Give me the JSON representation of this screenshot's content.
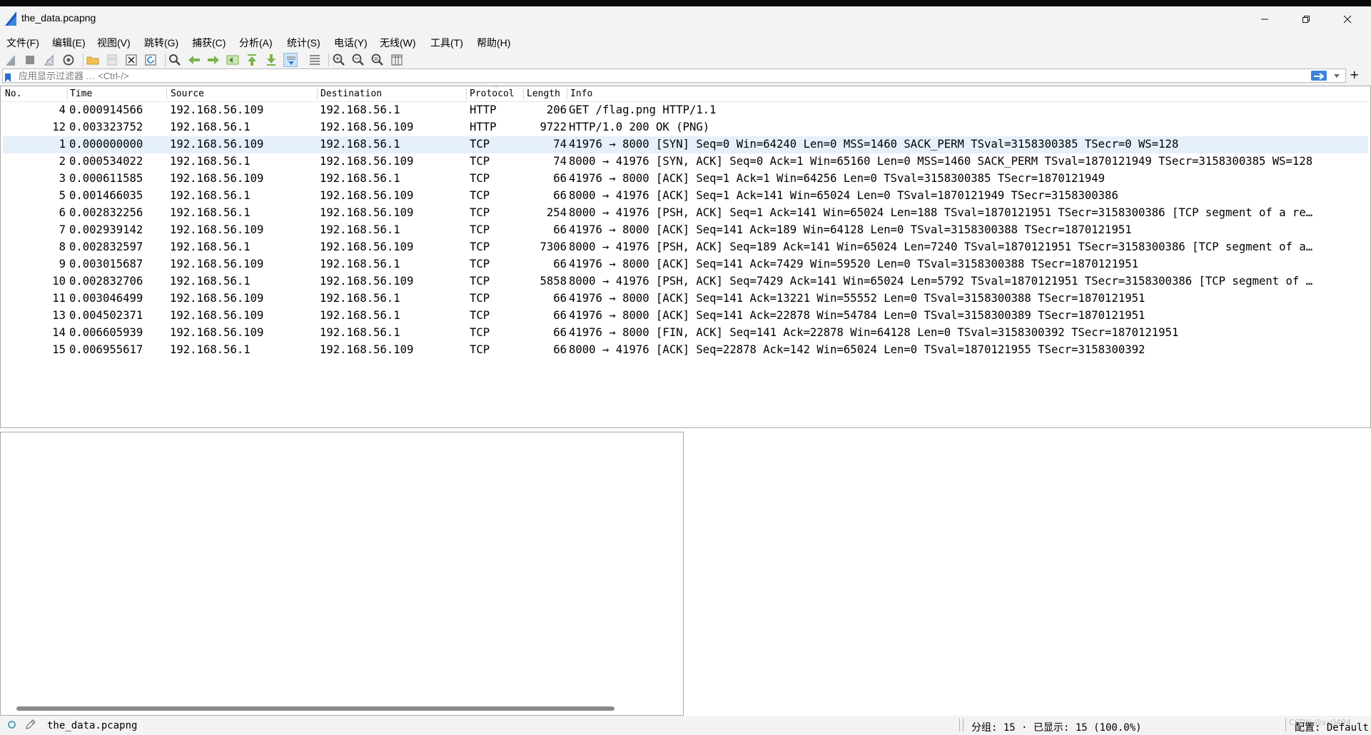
{
  "window": {
    "title": "the_data.pcapng",
    "icon": "wireshark-fin-icon",
    "controls": [
      "minimize-icon",
      "restore-icon",
      "close-icon"
    ]
  },
  "menu": [
    {
      "label": "文件(F)"
    },
    {
      "label": "编辑(E)"
    },
    {
      "label": "视图(V)"
    },
    {
      "label": "跳转(G)"
    },
    {
      "label": "捕获(C)"
    },
    {
      "label": "分析(A)"
    },
    {
      "label": "统计(S)"
    },
    {
      "label": "电话(Y)"
    },
    {
      "label": "无线(W)"
    },
    {
      "label": "工具(T)"
    },
    {
      "label": "帮助(H)"
    }
  ],
  "toolbar": {
    "icons": [
      "start-capture-icon",
      "stop-capture-icon",
      "restart-capture-icon",
      "capture-options-icon",
      "open-file-icon",
      "save-file-icon",
      "close-file-icon",
      "reload-file-icon",
      "find-packet-icon",
      "go-back-icon",
      "go-forward-icon",
      "go-to-packet-icon",
      "go-first-icon",
      "go-last-icon",
      "autoscroll-icon",
      "colorize-icon",
      "zoom-in-icon",
      "zoom-out-icon",
      "zoom-normal-icon",
      "resize-columns-icon"
    ]
  },
  "filter": {
    "placeholder": "应用显示过滤器 … <Ctrl-/>",
    "value": "",
    "apply_color": "#3c82d8",
    "add_label": "+"
  },
  "packet_list": {
    "columns": [
      "No.",
      "Time",
      "Source",
      "Destination",
      "Protocol",
      "Length",
      "Info"
    ],
    "selected_row_color": "#e6f0fb",
    "rows": [
      {
        "no": "4",
        "time": "0.000914566",
        "src": "192.168.56.109",
        "dst": "192.168.56.1",
        "proto": "HTTP",
        "len": "206",
        "info": "GET /flag.png HTTP/1.1"
      },
      {
        "no": "12",
        "time": "0.003323752",
        "src": "192.168.56.1",
        "dst": "192.168.56.109",
        "proto": "HTTP",
        "len": "9722",
        "info": "HTTP/1.0 200 OK  (PNG)"
      },
      {
        "no": "1",
        "time": "0.000000000",
        "src": "192.168.56.109",
        "dst": "192.168.56.1",
        "proto": "TCP",
        "len": "74",
        "info": "41976 → 8000 [SYN] Seq=0 Win=64240 Len=0 MSS=1460 SACK_PERM TSval=3158300385 TSecr=0 WS=128"
      },
      {
        "no": "2",
        "time": "0.000534022",
        "src": "192.168.56.1",
        "dst": "192.168.56.109",
        "proto": "TCP",
        "len": "74",
        "info": "8000 → 41976 [SYN, ACK] Seq=0 Ack=1 Win=65160 Len=0 MSS=1460 SACK_PERM TSval=1870121949 TSecr=3158300385 WS=128"
      },
      {
        "no": "3",
        "time": "0.000611585",
        "src": "192.168.56.109",
        "dst": "192.168.56.1",
        "proto": "TCP",
        "len": "66",
        "info": "41976 → 8000 [ACK] Seq=1 Ack=1 Win=64256 Len=0 TSval=3158300385 TSecr=1870121949"
      },
      {
        "no": "5",
        "time": "0.001466035",
        "src": "192.168.56.1",
        "dst": "192.168.56.109",
        "proto": "TCP",
        "len": "66",
        "info": "8000 → 41976 [ACK] Seq=1 Ack=141 Win=65024 Len=0 TSval=1870121949 TSecr=3158300386"
      },
      {
        "no": "6",
        "time": "0.002832256",
        "src": "192.168.56.1",
        "dst": "192.168.56.109",
        "proto": "TCP",
        "len": "254",
        "info": "8000 → 41976 [PSH, ACK] Seq=1 Ack=141 Win=65024 Len=188 TSval=1870121951 TSecr=3158300386 [TCP segment of a re…"
      },
      {
        "no": "7",
        "time": "0.002939142",
        "src": "192.168.56.109",
        "dst": "192.168.56.1",
        "proto": "TCP",
        "len": "66",
        "info": "41976 → 8000 [ACK] Seq=141 Ack=189 Win=64128 Len=0 TSval=3158300388 TSecr=1870121951"
      },
      {
        "no": "8",
        "time": "0.002832597",
        "src": "192.168.56.1",
        "dst": "192.168.56.109",
        "proto": "TCP",
        "len": "7306",
        "info": "8000 → 41976 [PSH, ACK] Seq=189 Ack=141 Win=65024 Len=7240 TSval=1870121951 TSecr=3158300386 [TCP segment of a…"
      },
      {
        "no": "9",
        "time": "0.003015687",
        "src": "192.168.56.109",
        "dst": "192.168.56.1",
        "proto": "TCP",
        "len": "66",
        "info": "41976 → 8000 [ACK] Seq=141 Ack=7429 Win=59520 Len=0 TSval=3158300388 TSecr=1870121951"
      },
      {
        "no": "10",
        "time": "0.002832706",
        "src": "192.168.56.1",
        "dst": "192.168.56.109",
        "proto": "TCP",
        "len": "5858",
        "info": "8000 → 41976 [PSH, ACK] Seq=7429 Ack=141 Win=65024 Len=5792 TSval=1870121951 TSecr=3158300386 [TCP segment of …"
      },
      {
        "no": "11",
        "time": "0.003046499",
        "src": "192.168.56.109",
        "dst": "192.168.56.1",
        "proto": "TCP",
        "len": "66",
        "info": "41976 → 8000 [ACK] Seq=141 Ack=13221 Win=55552 Len=0 TSval=3158300388 TSecr=1870121951"
      },
      {
        "no": "13",
        "time": "0.004502371",
        "src": "192.168.56.109",
        "dst": "192.168.56.1",
        "proto": "TCP",
        "len": "66",
        "info": "41976 → 8000 [ACK] Seq=141 Ack=22878 Win=54784 Len=0 TSval=3158300389 TSecr=1870121951"
      },
      {
        "no": "14",
        "time": "0.006605939",
        "src": "192.168.56.109",
        "dst": "192.168.56.1",
        "proto": "TCP",
        "len": "66",
        "info": "41976 → 8000 [FIN, ACK] Seq=141 Ack=22878 Win=64128 Len=0 TSval=3158300392 TSecr=1870121951"
      },
      {
        "no": "15",
        "time": "0.006955617",
        "src": "192.168.56.1",
        "dst": "192.168.56.109",
        "proto": "TCP",
        "len": "66",
        "info": "8000 → 41976 [ACK] Seq=22878 Ack=142 Win=65024 Len=0 TSval=1870121955 TSecr=3158300392"
      }
    ]
  },
  "statusbar": {
    "file": "the_data.pcapng",
    "packets": "分组: 15 · 已显示: 15 (100.0%)",
    "profile": "配置: Default",
    "watermark": "CSDN @xx0404"
  }
}
